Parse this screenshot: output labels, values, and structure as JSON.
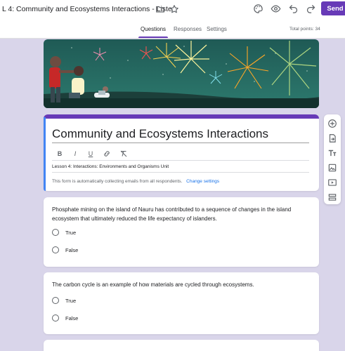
{
  "header": {
    "doc_title": "L 4: Community and Ecosystems Interactions  - Liste",
    "send_label": "Send"
  },
  "tabs": [
    {
      "label": "Questions",
      "active": true
    },
    {
      "label": "Responses",
      "active": false
    },
    {
      "label": "Settings",
      "active": false
    }
  ],
  "total_points": "Total points: 34",
  "form": {
    "title": "Community and Ecosystems Interactions",
    "description": "Lesson 4: Interactions: Environments and Organisms Unit",
    "email_note": "This form is automatically collecting emails from all respondents.",
    "change_settings": "Change settings",
    "format_buttons": [
      "B",
      "I",
      "U",
      "link",
      "clear"
    ]
  },
  "questions": [
    {
      "text": "Phosphate mining on the island of Nauru has contributed to a sequence of changes in the island ecosystem that ultimately reduced the life expectancy of islanders.",
      "options": [
        "True",
        "False"
      ]
    },
    {
      "text": "The carbon cycle is an example of how materials are cycled through ecosystems.",
      "options": [
        "True",
        "False"
      ]
    }
  ],
  "colors": {
    "accent": "#673ab7",
    "link": "#1a73e8",
    "background": "#d9d5ea"
  },
  "icons": {
    "title_icons": [
      "folder-icon",
      "star-icon"
    ],
    "toolbar_icons": [
      "palette-icon",
      "preview-eye-icon",
      "undo-icon",
      "redo-icon"
    ],
    "side_toolbar": [
      "add-question-icon",
      "import-questions-icon",
      "add-title-icon",
      "add-image-icon",
      "add-video-icon",
      "add-section-icon"
    ]
  }
}
